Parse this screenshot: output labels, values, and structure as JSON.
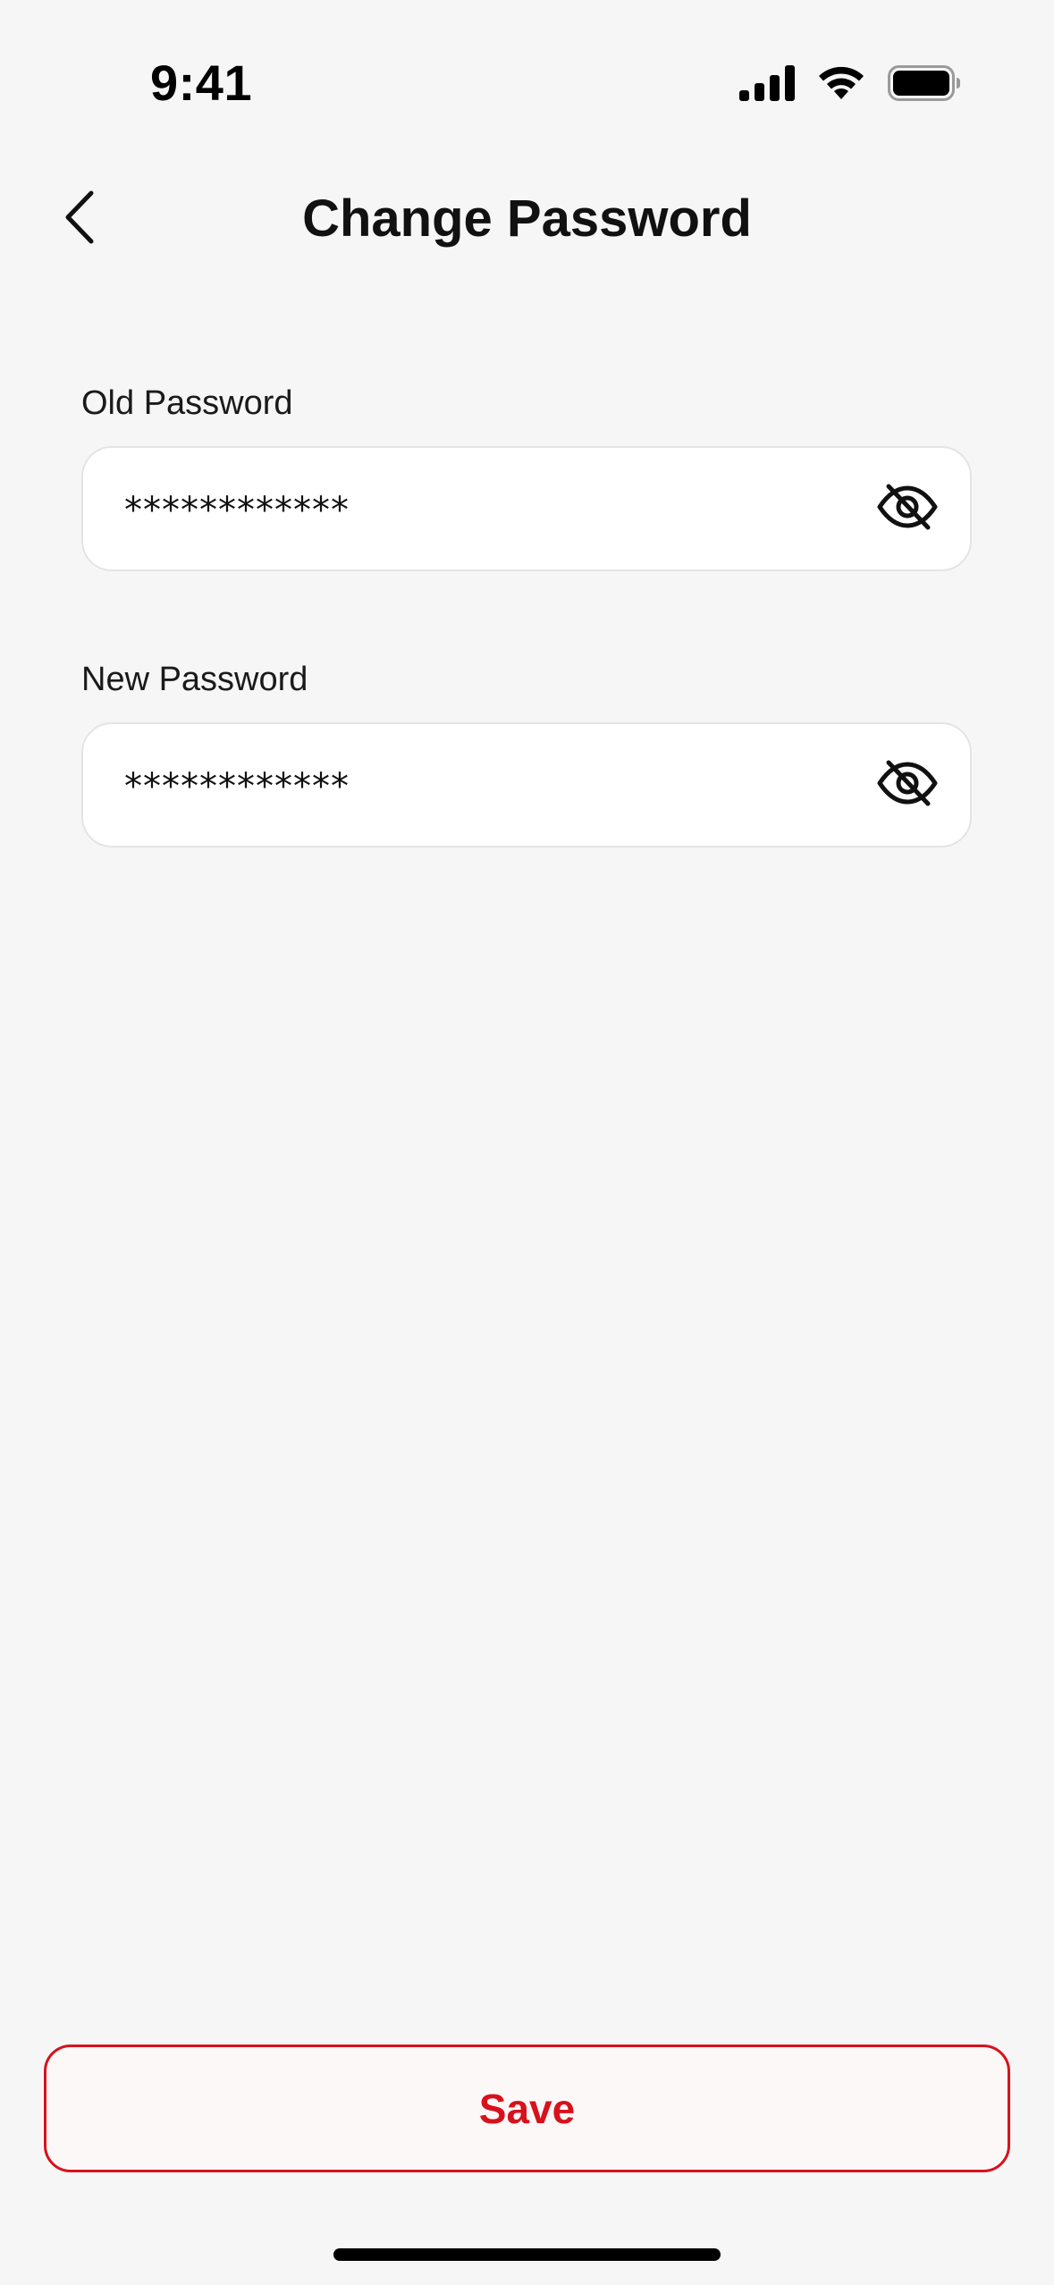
{
  "status_bar": {
    "time": "9:41",
    "icons": [
      "cellular-signal-icon",
      "wifi-icon",
      "battery-icon"
    ]
  },
  "header": {
    "title": "Change Password",
    "back_icon": "chevron-left-icon"
  },
  "form": {
    "old_password": {
      "label": "Old Password",
      "value": "************",
      "toggle_icon": "eye-slash-icon"
    },
    "new_password": {
      "label": "New Password",
      "value": "************",
      "toggle_icon": "eye-slash-icon"
    }
  },
  "actions": {
    "save_label": "Save"
  },
  "colors": {
    "background": "#f6f6f6",
    "accent": "#d7121d",
    "field_background": "#ffffff",
    "field_border": "#e4e4e4",
    "text": "#111111"
  }
}
